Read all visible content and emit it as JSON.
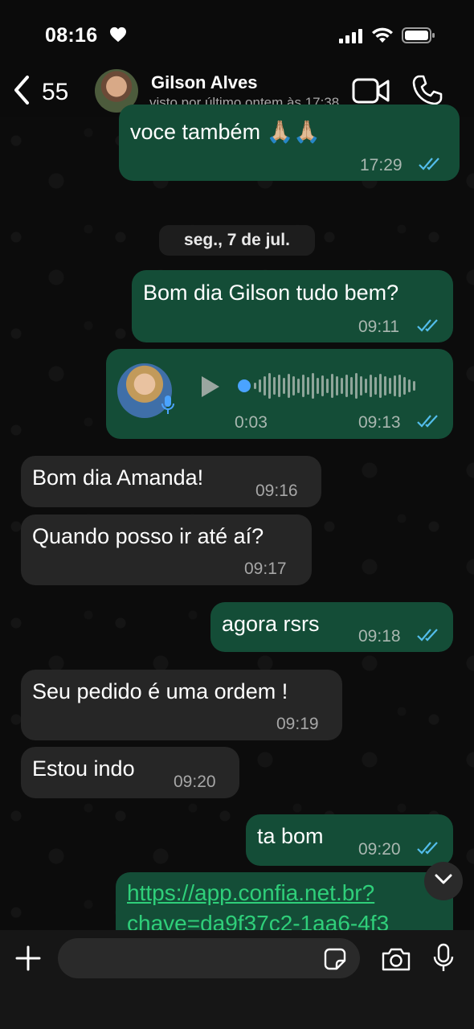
{
  "status_bar": {
    "time": "08:16"
  },
  "header": {
    "back_count": "55",
    "contact_name": "Gilson Alves",
    "last_seen": "visto por último ontem às 17:38"
  },
  "messages": [
    {
      "direction": "out",
      "text": "voce também 🙏🏼🙏🏼",
      "time": "17:29",
      "read": true
    },
    {
      "direction": "out",
      "text": "Bom dia Gilson tudo bem?",
      "time": "09:11",
      "read": true
    },
    {
      "direction": "out",
      "type": "voice",
      "duration": "0:03",
      "time": "09:13",
      "read": true
    },
    {
      "direction": "in",
      "text": "Bom dia Amanda!",
      "time": "09:16"
    },
    {
      "direction": "in",
      "text": "Quando posso ir até aí?",
      "time": "09:17"
    },
    {
      "direction": "out",
      "text": "agora rsrs",
      "time": "09:18",
      "read": true
    },
    {
      "direction": "in",
      "text": "Seu pedido é uma ordem !",
      "time": "09:19"
    },
    {
      "direction": "in",
      "text": "Estou indo",
      "time": "09:20"
    },
    {
      "direction": "out",
      "text": "ta bom",
      "time": "09:20",
      "read": true
    },
    {
      "direction": "out",
      "type": "link",
      "line1": "https://app.confia.net.br?",
      "line2": "chave=da9f37c2-1aa6-4f3"
    }
  ],
  "date_separator": "seg., 7 de jul.",
  "composer": {
    "placeholder": ""
  },
  "colors": {
    "outgoing_bubble": "#144d37",
    "incoming_bubble": "#262626",
    "read_ticks": "#53bdeb",
    "link": "#2fcf7a",
    "voice_accent": "#4aa3ff"
  },
  "icons": [
    "heart-icon",
    "signal-icon",
    "wifi-icon",
    "battery-icon",
    "back-chevron-icon",
    "video-call-icon",
    "phone-icon",
    "play-icon",
    "mic-badge-icon",
    "chevron-down-icon",
    "plus-icon",
    "sticker-icon",
    "camera-icon",
    "microphone-icon"
  ]
}
